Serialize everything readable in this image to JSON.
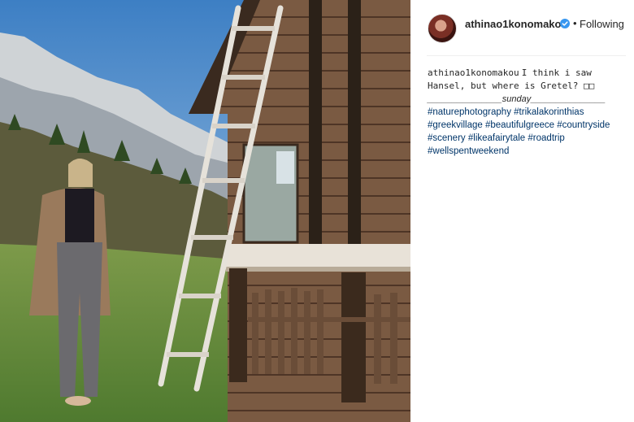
{
  "post": {
    "username": "athinao1konomakou",
    "separator": "•",
    "follow_label": "Following",
    "caption_user": "athinao1konomakou",
    "caption_text": "I think i saw Hansel, but where is Gretel? □□",
    "caption_divider": "_______________sunday_______________",
    "hashtags": [
      "#naturephotography",
      "#trikalakorinthias",
      "#greekvillage",
      "#beautifulgreece",
      "#countryside",
      "#scenery",
      "#likeafairytale",
      "#roadtrip",
      "#wellspentweekend"
    ]
  },
  "colors": {
    "verified_badge": "#3897f0",
    "hashtag": "#003569",
    "text": "#262626"
  },
  "icons": {
    "verified": "verified-badge-icon"
  }
}
